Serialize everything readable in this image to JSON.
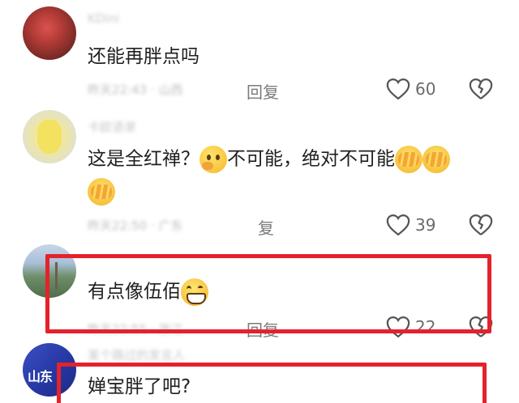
{
  "comments": [
    {
      "username": "KDini",
      "text": "还能再胖点吗",
      "meta": "昨天22:43 · 山西",
      "reply_label": "回复",
      "likes": "60"
    },
    {
      "username": "卡欧语录",
      "text_parts": [
        "这是全红禅？",
        "不可能，绝对不可能"
      ],
      "emojis": [
        "thinking-emoji",
        "facepalm-emoji",
        "facepalm-emoji",
        "facepalm-emoji"
      ],
      "meta": "昨天22:50 · 广东",
      "reply_label": "复",
      "likes": "39"
    },
    {
      "username": "",
      "text": "有点像伍佰",
      "emojis": [
        "grinning-emoji"
      ],
      "meta": "昨天22:55 · 浙江",
      "reply_label": "回复",
      "likes": "22"
    },
    {
      "username": "某个路过的发言人",
      "text": "婵宝胖了吧?",
      "avatar_text": "山东"
    }
  ],
  "colors": {
    "highlight": "#e4222b",
    "secondary_text": "#7a7a7a"
  }
}
